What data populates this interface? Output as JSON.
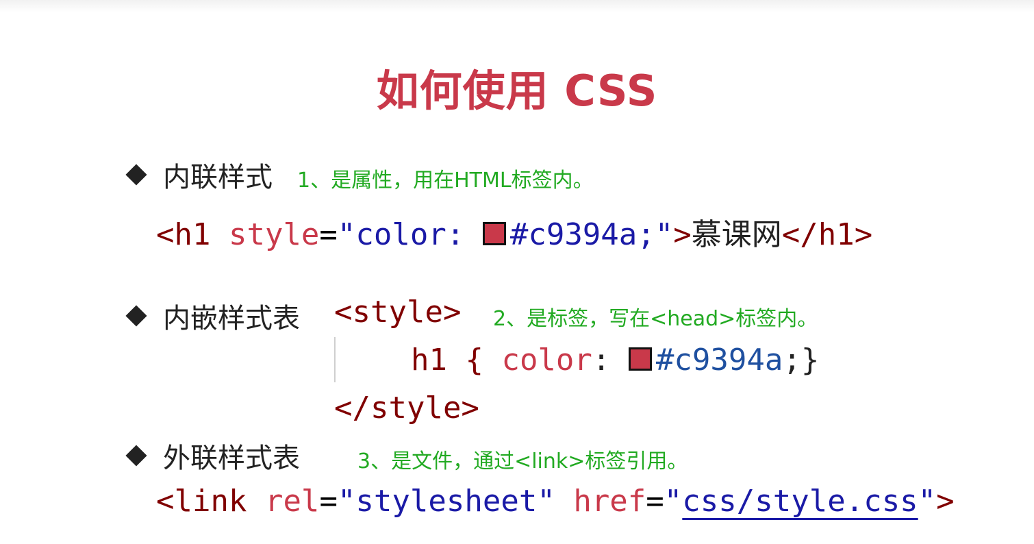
{
  "title": "如何使用 CSS",
  "colors": {
    "accent": "#c9394a",
    "note": "#22aa22",
    "string": "#1a1aa6"
  },
  "sections": [
    {
      "label": "内联样式",
      "note": "1、是属性，用在HTML标签内。",
      "code": {
        "open": "<h1 ",
        "attr": "style",
        "eq": "=",
        "quote_open": "\"color: ",
        "value": "#c9394a;",
        "quote_close": "\"",
        "gt": ">",
        "text": "慕课网",
        "close": "</h1>"
      }
    },
    {
      "label": "内嵌样式表",
      "note": "2、是标签，写在<head>标签内。",
      "code": {
        "open": "<style>",
        "selector": "h1 { ",
        "prop": "color",
        "colon": ": ",
        "value": "#c9394a",
        "end": ";}",
        "close": "</style>"
      }
    },
    {
      "label": "外联样式表",
      "note": "3、是文件，通过<link>标签引用。",
      "code": {
        "open": "<link ",
        "attr1": "rel",
        "eq": "=",
        "val1": "\"stylesheet\"",
        "space": " ",
        "attr2": "href",
        "quote_open": "\"",
        "href": "css/style.css",
        "quote_close": "\"",
        "gt": ">"
      }
    }
  ]
}
